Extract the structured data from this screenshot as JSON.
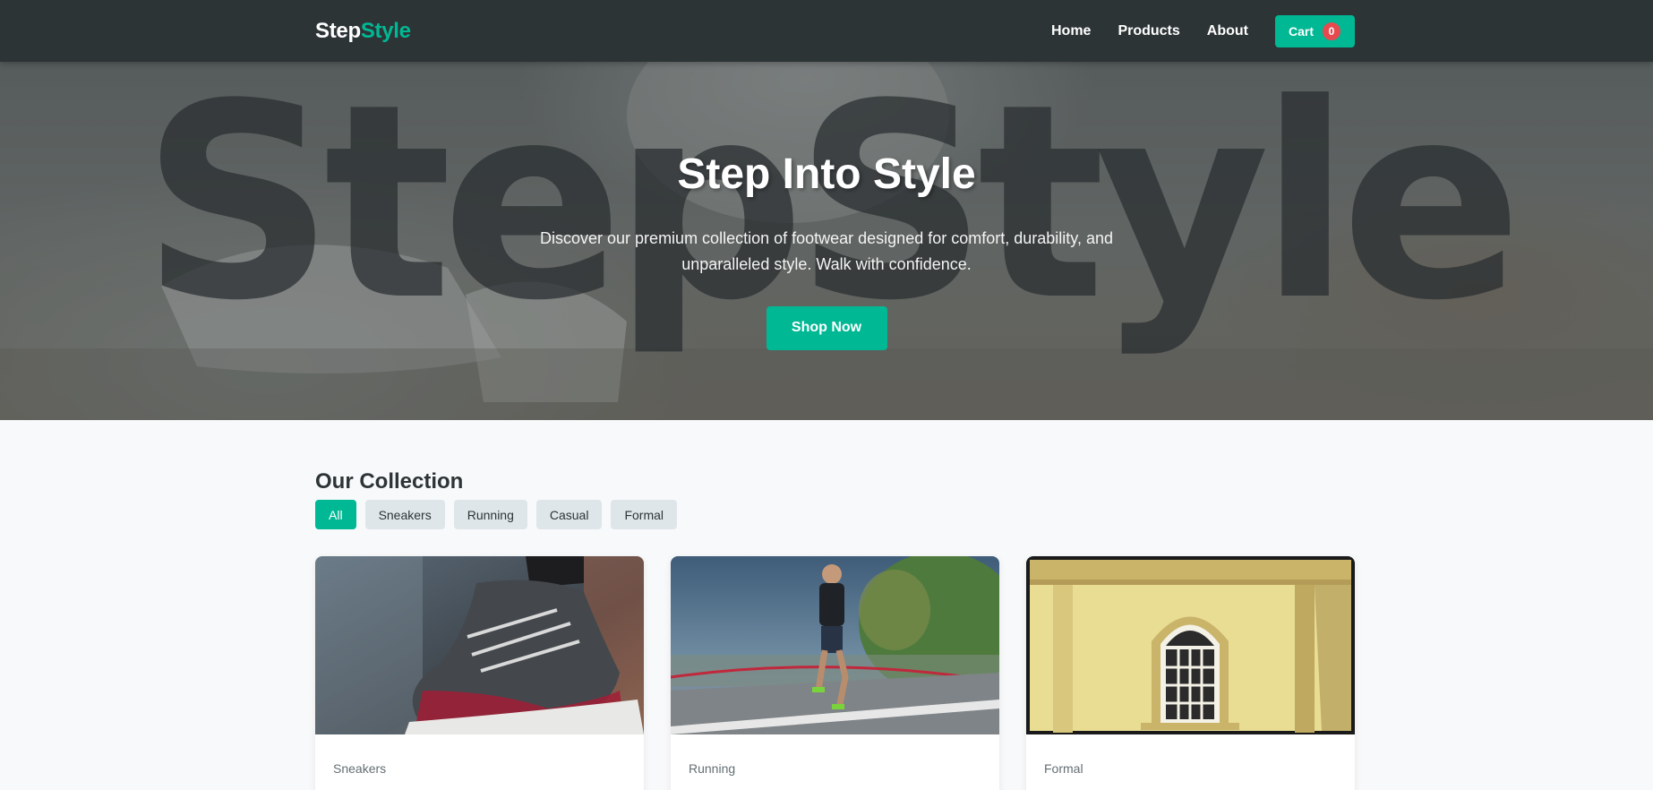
{
  "nav": {
    "logo_part1": "Step",
    "logo_part2": "Style",
    "links": [
      "Home",
      "Products",
      "About"
    ],
    "cart_label": "Cart",
    "cart_count": "0"
  },
  "hero": {
    "watermark": "StepStyle",
    "title": "Step Into Style",
    "subtitle": "Discover our premium collection of footwear designed for comfort, durability, and unparalleled style. Walk with confidence.",
    "cta": "Shop Now"
  },
  "collection": {
    "title": "Our Collection",
    "filters": [
      {
        "label": "All",
        "active": true
      },
      {
        "label": "Sneakers",
        "active": false
      },
      {
        "label": "Running",
        "active": false
      },
      {
        "label": "Casual",
        "active": false
      },
      {
        "label": "Formal",
        "active": false
      }
    ],
    "products": [
      {
        "category": "Sneakers",
        "image": "sneaker-closeup-photo"
      },
      {
        "category": "Running",
        "image": "runner-on-road-photo"
      },
      {
        "category": "Formal",
        "image": "yellow-building-window-photo"
      }
    ]
  },
  "colors": {
    "accent": "#00b894",
    "nav_bg": "#2d3436",
    "badge": "#e64a4f",
    "page_bg": "#f8f9fa",
    "filter_bg": "#dfe6e9"
  }
}
